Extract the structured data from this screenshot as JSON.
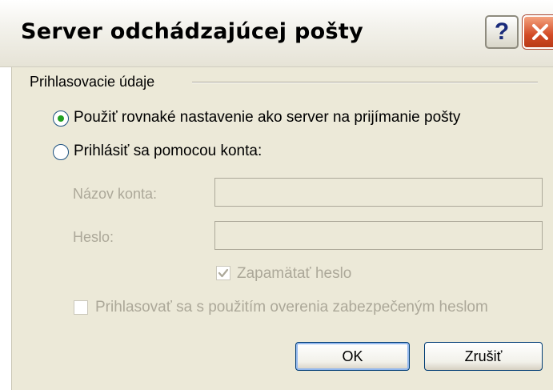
{
  "dialog": {
    "title": "Server odchádzajúcej pošty",
    "help_glyph": "?",
    "help_icon": "help-icon",
    "close_icon": "close-icon"
  },
  "group": {
    "label": "Prihlasovacie údaje"
  },
  "options": {
    "same_as_incoming": {
      "label": "Použiť rovnaké nastavenie ako server na prijímanie pošty",
      "checked": true
    },
    "login_with_account": {
      "label": "Prihlásiť sa pomocou konta:",
      "checked": false
    }
  },
  "fields": {
    "account_name": {
      "label": "Názov konta:",
      "value": "",
      "enabled": false
    },
    "password": {
      "label": "Heslo:",
      "value": "",
      "enabled": false
    }
  },
  "checkboxes": {
    "remember_password": {
      "label": "Zapamätať heslo",
      "checked": true,
      "enabled": false
    },
    "spa_auth": {
      "label": "Prihlasovať sa s použitím overenia zabezpečeným heslom",
      "checked": false,
      "enabled": false
    }
  },
  "buttons": {
    "ok": "OK",
    "cancel": "Zrušiť"
  },
  "colors": {
    "dialog_bg": "#ece9d8",
    "disabled_text": "#aca899",
    "radio_dot": "#21a121",
    "close_red": "#d24a25"
  }
}
